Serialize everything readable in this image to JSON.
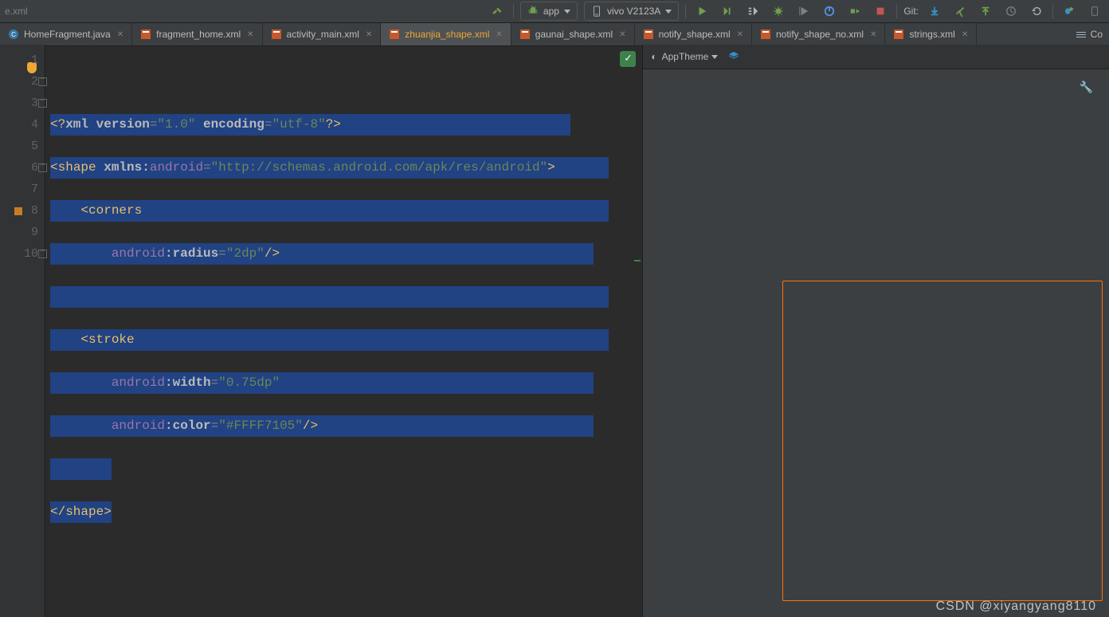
{
  "breadcrumb": "e.xml",
  "run_config": {
    "label": "app",
    "device": "vivo V2123A"
  },
  "git": {
    "label": "Git:"
  },
  "tabs": [
    {
      "label": "HomeFragment.java",
      "type": "java"
    },
    {
      "label": "fragment_home.xml",
      "type": "layout"
    },
    {
      "label": "activity_main.xml",
      "type": "layout"
    },
    {
      "label": "zhuanjia_shape.xml",
      "type": "drawable",
      "active": true
    },
    {
      "label": "gaunai_shape.xml",
      "type": "drawable"
    },
    {
      "label": "notify_shape.xml",
      "type": "drawable"
    },
    {
      "label": "notify_shape_no.xml",
      "type": "drawable"
    },
    {
      "label": "strings.xml",
      "type": "values"
    }
  ],
  "tabs_right_label": "Co",
  "code": {
    "lines": [
      1,
      2,
      3,
      4,
      5,
      6,
      7,
      8,
      9,
      10
    ],
    "l1_a": "<?",
    "l1_b": "xml version",
    "l1_c": "=",
    "l1_v1": "\"1.0\"",
    "l1_d": " encoding",
    "l1_e": "=",
    "l1_v2": "\"utf-8\"",
    "l1_f": "?>",
    "l2_a": "<",
    "l2_b": "shape",
    "l2_c": " xmlns:",
    "l2_d": "android",
    "l2_e": "=",
    "l2_v": "\"http://schemas.android.com/apk/res/android\"",
    "l2_f": ">",
    "l3_a": "    <",
    "l3_b": "corners",
    "l4_pad": "        ",
    "l4_a": "android",
    "l4_b": ":",
    "l4_c": "radius",
    "l4_d": "=",
    "l4_v": "\"2dp\"",
    "l4_e": "/>",
    "l6_a": "    <",
    "l6_b": "stroke",
    "l7_pad": "        ",
    "l7_a": "android",
    "l7_b": ":",
    "l7_c": "width",
    "l7_d": "=",
    "l7_v": "\"0.75dp\"",
    "l8_pad": "        ",
    "l8_a": "android",
    "l8_b": ":",
    "l8_c": "color",
    "l8_d": "=",
    "l8_v": "\"#FFFF7105\"",
    "l8_e": "/>",
    "l10_a": "</",
    "l10_b": "shape",
    "l10_c": ">"
  },
  "preview": {
    "theme": "AppTheme"
  },
  "watermark": "CSDN @xiyangyang8110"
}
